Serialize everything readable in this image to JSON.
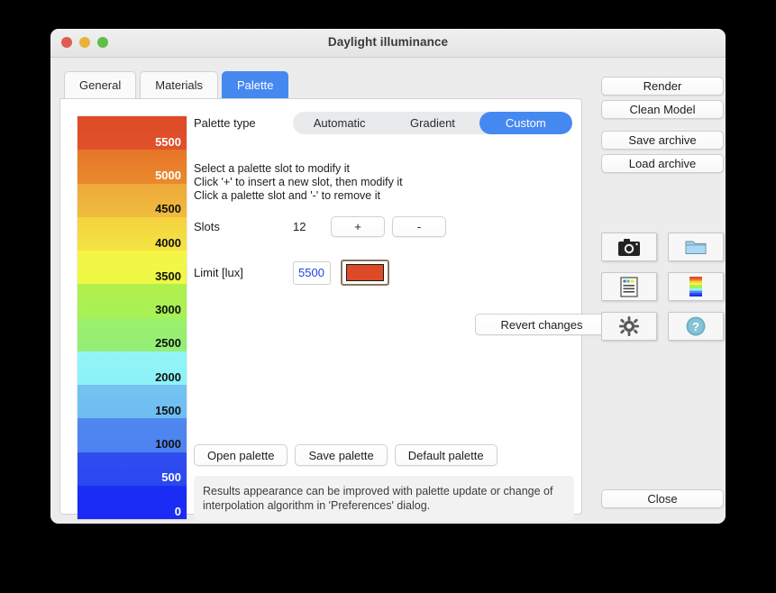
{
  "window": {
    "title": "Daylight illuminance",
    "traffic_lights": [
      {
        "name": "close-button",
        "color": "#e05c52"
      },
      {
        "name": "minimize-button",
        "color": "#e8b33c"
      },
      {
        "name": "zoom-button",
        "color": "#62bd48"
      }
    ]
  },
  "tabs": [
    {
      "label": "General",
      "active": false
    },
    {
      "label": "Materials",
      "active": false
    },
    {
      "label": "Palette",
      "active": true
    }
  ],
  "palette": {
    "slots": [
      {
        "label": "5500",
        "color": "#dd4a27",
        "color_end": "#e0522a",
        "text_color": "#ffffff"
      },
      {
        "label": "5000",
        "color": "#e7752a",
        "color_end": "#e98a2c",
        "text_color": "#ffffff"
      },
      {
        "label": "4500",
        "color": "#eda93a",
        "color_end": "#f0bc3e",
        "text_color": "#111111"
      },
      {
        "label": "4000",
        "color": "#f4d23f",
        "color_end": "#f4e443",
        "text_color": "#111111"
      },
      {
        "label": "3500",
        "color": "#f6f546",
        "color_end": "#edf845",
        "text_color": "#111111"
      },
      {
        "label": "3000",
        "color": "#b2f04c",
        "color_end": "#a6f157",
        "text_color": "#111111"
      },
      {
        "label": "2500",
        "color": "#9cf06a",
        "color_end": "#93ee78",
        "text_color": "#111111"
      },
      {
        "label": "2000",
        "color": "#92f5f7",
        "color_end": "#8cf2f8",
        "text_color": "#111111"
      },
      {
        "label": "1500",
        "color": "#73c3f2",
        "color_end": "#6ebdf2",
        "text_color": "#111111"
      },
      {
        "label": "1000",
        "color": "#5187f0",
        "color_end": "#4d83f1",
        "text_color": "#111111"
      },
      {
        "label": "500",
        "color": "#2f4ef0",
        "color_end": "#2b47ef",
        "text_color": "#ffffff"
      },
      {
        "label": "0",
        "color": "#1b2ef4",
        "color_end": "#1a2bf5",
        "text_color": "#ffffff"
      }
    ]
  },
  "controls": {
    "palette_type_label": "Palette type",
    "palette_type_options": [
      "Automatic",
      "Gradient",
      "Custom"
    ],
    "palette_type_selected": "Custom",
    "hints": [
      "Select a palette slot to modify it",
      "Click '+' to insert a new slot, then modify it",
      "Click a palette slot and '-' to remove it"
    ],
    "slots_label": "Slots",
    "slots_count": "12",
    "plus_label": "+",
    "minus_label": "-",
    "limit_label": "Limit [lux]",
    "limit_value": "5500",
    "limit_swatch_color": "#dd4a27",
    "revert_label": "Revert changes",
    "open_palette_label": "Open palette",
    "save_palette_label": "Save palette",
    "default_palette_label": "Default palette",
    "banner_line1": "Results appearance can be improved with palette update or change of",
    "banner_line2": "interpolation algorithm in 'Preferences' dialog."
  },
  "sidebar": {
    "buttons": [
      {
        "label": "Render"
      },
      {
        "label": "Clean Model"
      },
      {
        "label": "Save archive"
      },
      {
        "label": "Load archive"
      }
    ],
    "icons": [
      {
        "name": "camera-icon",
        "glyph": "📷"
      },
      {
        "name": "folder-icon",
        "glyph": "📁"
      },
      {
        "name": "report-icon",
        "glyph": "📋"
      },
      {
        "name": "palette-icon",
        "glyph": ""
      },
      {
        "name": "settings-gear-icon",
        "glyph": "⚙"
      },
      {
        "name": "help-icon",
        "glyph": "?"
      }
    ],
    "close_label": "Close"
  }
}
